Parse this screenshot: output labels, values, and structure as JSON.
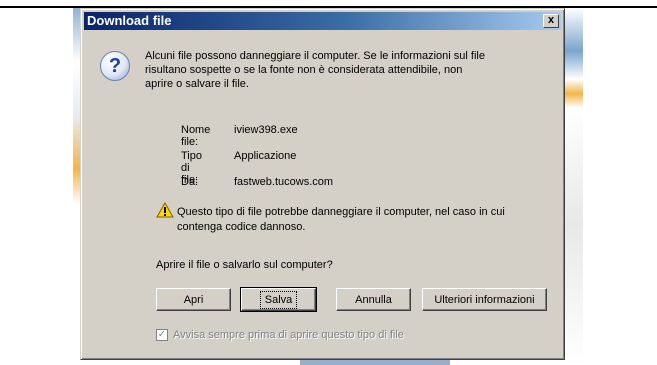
{
  "dialog": {
    "title": "Download file",
    "close_label": "x",
    "message": "Alcuni file possono danneggiare il computer. Se le informazioni sul file risultano sospette o se la fonte non è considerata attendibile, non aprire o salvare il file.",
    "file_info": [
      {
        "label": "Nome file:",
        "value": "iview398.exe"
      },
      {
        "label": "Tipo di file:",
        "value": "Applicazione"
      },
      {
        "label": "Da:",
        "value": "fastweb.tucows.com"
      }
    ],
    "warning": "Questo tipo di file potrebbe danneggiare il computer, nel caso in cui contenga codice dannoso.",
    "question": "Aprire il file o salvarlo sul computer?",
    "buttons": {
      "open": "Apri",
      "save": "Salva",
      "cancel": "Annulla",
      "more_info": "Ulteriori informazioni"
    },
    "checkbox": {
      "label": "Avvisa sempre prima di aprire questo tipo di file",
      "checked": true,
      "enabled": false
    }
  },
  "icons": {
    "question": "question-icon",
    "warning": "warning-icon",
    "close": "close-icon"
  },
  "colors": {
    "titlebar_start": "#0a246a",
    "titlebar_end": "#a6caf0",
    "dialog_bg": "#d4d0c8"
  }
}
